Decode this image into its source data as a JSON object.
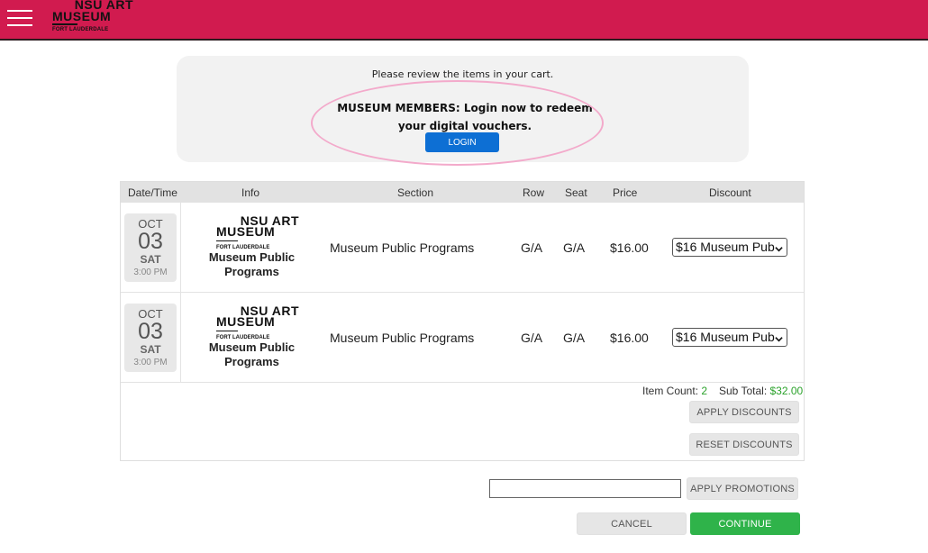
{
  "header": {
    "logo_line1": "NSU ART",
    "logo_line2": "MUSEUM",
    "logo_line3": "FORT LAUDERDALE",
    "bg_color": "#d11b4f",
    "menu_icon": "hamburger-menu-icon"
  },
  "notice": {
    "review_text": "Please review the items in your cart.",
    "members_line1": "MUSEUM MEMBERS: Login now to redeem",
    "members_line2": "your digital vouchers.",
    "login_label": "LOGIN"
  },
  "table": {
    "columns": [
      "Date/Time",
      "Info",
      "Section",
      "Row",
      "Seat",
      "Price",
      "Discount"
    ],
    "rows": [
      {
        "month": "OCT",
        "day": "03",
        "weekday": "SAT",
        "time": "3:00 PM",
        "logo_line1": "NSU ART",
        "logo_line2": "MUSEUM",
        "logo_line3": "FORT LAUDERDALE",
        "event_line1": "Museum Public",
        "event_line2": "Programs",
        "section": "Museum Public Programs",
        "row": "G/A",
        "seat": "G/A",
        "price": "$16.00",
        "discount": "$16 Museum Pub"
      },
      {
        "month": "OCT",
        "day": "03",
        "weekday": "SAT",
        "time": "3:00 PM",
        "logo_line1": "NSU ART",
        "logo_line2": "MUSEUM",
        "logo_line3": "FORT LAUDERDALE",
        "event_line1": "Museum Public",
        "event_line2": "Programs",
        "section": "Museum Public Programs",
        "row": "G/A",
        "seat": "G/A",
        "price": "$16.00",
        "discount": "$16 Museum Pub"
      }
    ]
  },
  "summary": {
    "item_count_label": "Item Count:",
    "item_count": "2",
    "subtotal_label": "Sub Total:",
    "subtotal": "$32.00",
    "apply_discounts": "APPLY DISCOUNTS",
    "reset_discounts": "RESET DISCOUNTS"
  },
  "promo": {
    "input_value": "",
    "placeholder": "",
    "apply_label": "APPLY PROMOTIONS"
  },
  "actions": {
    "cancel": "CANCEL",
    "continue": "CONTINUE",
    "continue_color": "#2fb34a"
  }
}
